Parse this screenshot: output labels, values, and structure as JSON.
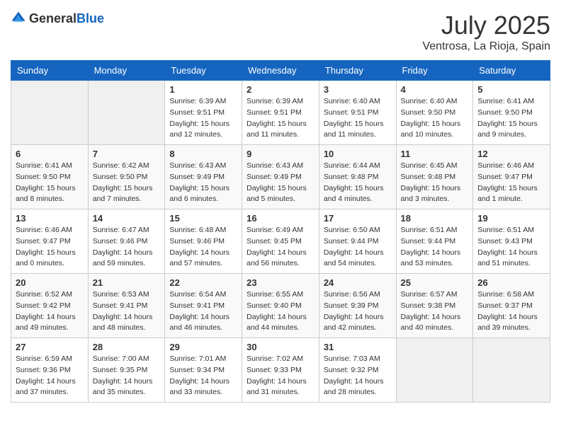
{
  "header": {
    "logo": {
      "general": "General",
      "blue": "Blue"
    },
    "title": "July 2025",
    "location": "Ventrosa, La Rioja, Spain"
  },
  "weekdays": [
    "Sunday",
    "Monday",
    "Tuesday",
    "Wednesday",
    "Thursday",
    "Friday",
    "Saturday"
  ],
  "weeks": [
    [
      {
        "day": "",
        "sunrise": "",
        "sunset": "",
        "daylight": ""
      },
      {
        "day": "",
        "sunrise": "",
        "sunset": "",
        "daylight": ""
      },
      {
        "day": "1",
        "sunrise": "Sunrise: 6:39 AM",
        "sunset": "Sunset: 9:51 PM",
        "daylight": "Daylight: 15 hours and 12 minutes."
      },
      {
        "day": "2",
        "sunrise": "Sunrise: 6:39 AM",
        "sunset": "Sunset: 9:51 PM",
        "daylight": "Daylight: 15 hours and 11 minutes."
      },
      {
        "day": "3",
        "sunrise": "Sunrise: 6:40 AM",
        "sunset": "Sunset: 9:51 PM",
        "daylight": "Daylight: 15 hours and 11 minutes."
      },
      {
        "day": "4",
        "sunrise": "Sunrise: 6:40 AM",
        "sunset": "Sunset: 9:50 PM",
        "daylight": "Daylight: 15 hours and 10 minutes."
      },
      {
        "day": "5",
        "sunrise": "Sunrise: 6:41 AM",
        "sunset": "Sunset: 9:50 PM",
        "daylight": "Daylight: 15 hours and 9 minutes."
      }
    ],
    [
      {
        "day": "6",
        "sunrise": "Sunrise: 6:41 AM",
        "sunset": "Sunset: 9:50 PM",
        "daylight": "Daylight: 15 hours and 8 minutes."
      },
      {
        "day": "7",
        "sunrise": "Sunrise: 6:42 AM",
        "sunset": "Sunset: 9:50 PM",
        "daylight": "Daylight: 15 hours and 7 minutes."
      },
      {
        "day": "8",
        "sunrise": "Sunrise: 6:43 AM",
        "sunset": "Sunset: 9:49 PM",
        "daylight": "Daylight: 15 hours and 6 minutes."
      },
      {
        "day": "9",
        "sunrise": "Sunrise: 6:43 AM",
        "sunset": "Sunset: 9:49 PM",
        "daylight": "Daylight: 15 hours and 5 minutes."
      },
      {
        "day": "10",
        "sunrise": "Sunrise: 6:44 AM",
        "sunset": "Sunset: 9:48 PM",
        "daylight": "Daylight: 15 hours and 4 minutes."
      },
      {
        "day": "11",
        "sunrise": "Sunrise: 6:45 AM",
        "sunset": "Sunset: 9:48 PM",
        "daylight": "Daylight: 15 hours and 3 minutes."
      },
      {
        "day": "12",
        "sunrise": "Sunrise: 6:46 AM",
        "sunset": "Sunset: 9:47 PM",
        "daylight": "Daylight: 15 hours and 1 minute."
      }
    ],
    [
      {
        "day": "13",
        "sunrise": "Sunrise: 6:46 AM",
        "sunset": "Sunset: 9:47 PM",
        "daylight": "Daylight: 15 hours and 0 minutes."
      },
      {
        "day": "14",
        "sunrise": "Sunrise: 6:47 AM",
        "sunset": "Sunset: 9:46 PM",
        "daylight": "Daylight: 14 hours and 59 minutes."
      },
      {
        "day": "15",
        "sunrise": "Sunrise: 6:48 AM",
        "sunset": "Sunset: 9:46 PM",
        "daylight": "Daylight: 14 hours and 57 minutes."
      },
      {
        "day": "16",
        "sunrise": "Sunrise: 6:49 AM",
        "sunset": "Sunset: 9:45 PM",
        "daylight": "Daylight: 14 hours and 56 minutes."
      },
      {
        "day": "17",
        "sunrise": "Sunrise: 6:50 AM",
        "sunset": "Sunset: 9:44 PM",
        "daylight": "Daylight: 14 hours and 54 minutes."
      },
      {
        "day": "18",
        "sunrise": "Sunrise: 6:51 AM",
        "sunset": "Sunset: 9:44 PM",
        "daylight": "Daylight: 14 hours and 53 minutes."
      },
      {
        "day": "19",
        "sunrise": "Sunrise: 6:51 AM",
        "sunset": "Sunset: 9:43 PM",
        "daylight": "Daylight: 14 hours and 51 minutes."
      }
    ],
    [
      {
        "day": "20",
        "sunrise": "Sunrise: 6:52 AM",
        "sunset": "Sunset: 9:42 PM",
        "daylight": "Daylight: 14 hours and 49 minutes."
      },
      {
        "day": "21",
        "sunrise": "Sunrise: 6:53 AM",
        "sunset": "Sunset: 9:41 PM",
        "daylight": "Daylight: 14 hours and 48 minutes."
      },
      {
        "day": "22",
        "sunrise": "Sunrise: 6:54 AM",
        "sunset": "Sunset: 9:41 PM",
        "daylight": "Daylight: 14 hours and 46 minutes."
      },
      {
        "day": "23",
        "sunrise": "Sunrise: 6:55 AM",
        "sunset": "Sunset: 9:40 PM",
        "daylight": "Daylight: 14 hours and 44 minutes."
      },
      {
        "day": "24",
        "sunrise": "Sunrise: 6:56 AM",
        "sunset": "Sunset: 9:39 PM",
        "daylight": "Daylight: 14 hours and 42 minutes."
      },
      {
        "day": "25",
        "sunrise": "Sunrise: 6:57 AM",
        "sunset": "Sunset: 9:38 PM",
        "daylight": "Daylight: 14 hours and 40 minutes."
      },
      {
        "day": "26",
        "sunrise": "Sunrise: 6:58 AM",
        "sunset": "Sunset: 9:37 PM",
        "daylight": "Daylight: 14 hours and 39 minutes."
      }
    ],
    [
      {
        "day": "27",
        "sunrise": "Sunrise: 6:59 AM",
        "sunset": "Sunset: 9:36 PM",
        "daylight": "Daylight: 14 hours and 37 minutes."
      },
      {
        "day": "28",
        "sunrise": "Sunrise: 7:00 AM",
        "sunset": "Sunset: 9:35 PM",
        "daylight": "Daylight: 14 hours and 35 minutes."
      },
      {
        "day": "29",
        "sunrise": "Sunrise: 7:01 AM",
        "sunset": "Sunset: 9:34 PM",
        "daylight": "Daylight: 14 hours and 33 minutes."
      },
      {
        "day": "30",
        "sunrise": "Sunrise: 7:02 AM",
        "sunset": "Sunset: 9:33 PM",
        "daylight": "Daylight: 14 hours and 31 minutes."
      },
      {
        "day": "31",
        "sunrise": "Sunrise: 7:03 AM",
        "sunset": "Sunset: 9:32 PM",
        "daylight": "Daylight: 14 hours and 28 minutes."
      },
      {
        "day": "",
        "sunrise": "",
        "sunset": "",
        "daylight": ""
      },
      {
        "day": "",
        "sunrise": "",
        "sunset": "",
        "daylight": ""
      }
    ]
  ]
}
